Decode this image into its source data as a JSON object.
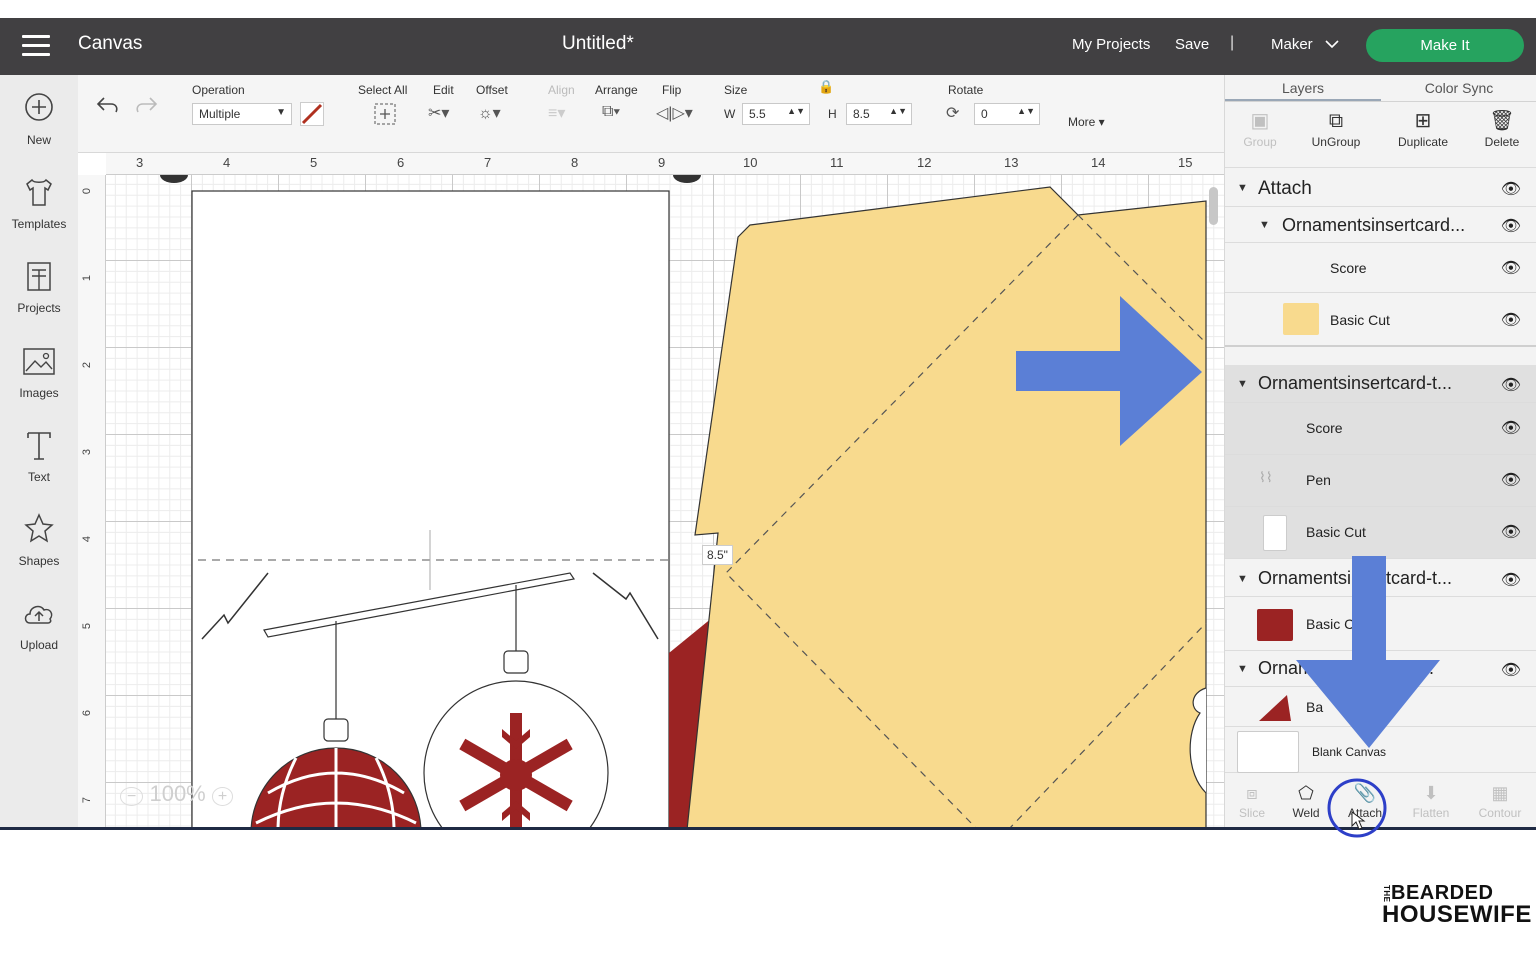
{
  "header": {
    "app_name": "Canvas",
    "doc_title": "Untitled*",
    "my_projects": "My Projects",
    "save": "Save",
    "separator": "|",
    "machine": "Maker",
    "make_it": "Make It"
  },
  "leftbar": {
    "items": [
      {
        "label": "New",
        "icon": "plus-circle-icon"
      },
      {
        "label": "Templates",
        "icon": "shirt-icon"
      },
      {
        "label": "Projects",
        "icon": "projects-icon"
      },
      {
        "label": "Images",
        "icon": "image-icon"
      },
      {
        "label": "Text",
        "icon": "text-icon"
      },
      {
        "label": "Shapes",
        "icon": "shapes-icon"
      },
      {
        "label": "Upload",
        "icon": "upload-cloud-icon"
      }
    ]
  },
  "toolbar": {
    "operation_label": "Operation",
    "operation_value": "Multiple",
    "select_all": "Select All",
    "edit": "Edit",
    "offset": "Offset",
    "align": "Align",
    "arrange": "Arrange",
    "flip": "Flip",
    "size": "Size",
    "width_prefix": "W",
    "width_value": "5.5",
    "height_prefix": "H",
    "height_value": "8.5",
    "rotate": "Rotate",
    "rotate_value": "0",
    "more": "More ▾"
  },
  "canvas": {
    "ruler_top": [
      "3",
      "4",
      "5",
      "6",
      "7",
      "8",
      "9",
      "10",
      "11",
      "12",
      "13",
      "14",
      "15"
    ],
    "ruler_left": [
      "0",
      "1",
      "2",
      "3",
      "4",
      "5",
      "6",
      "7"
    ],
    "dimension_tag": "8.5\"",
    "zoom": "100%",
    "colors": {
      "envelope": "#f8da8e",
      "ornament_red": "#9b2323",
      "outline": "#333333"
    }
  },
  "rightpanel": {
    "tabs": [
      "Layers",
      "Color Sync"
    ],
    "top_tools": [
      {
        "label": "Group",
        "icon": "group-icon",
        "enabled": false
      },
      {
        "label": "UnGroup",
        "icon": "ungroup-icon",
        "enabled": true
      },
      {
        "label": "Duplicate",
        "icon": "duplicate-icon",
        "enabled": true
      },
      {
        "label": "Delete",
        "icon": "trash-icon",
        "enabled": true
      }
    ],
    "layers": {
      "attach": "Attach",
      "group1": "Ornamentsinsertcard...",
      "g1_score": "Score",
      "g1_basic_cut": "Basic Cut",
      "group2": "Ornamentsinsertcard-t...",
      "g2_score": "Score",
      "g2_pen": "Pen",
      "g2_basic_cut": "Basic Cut",
      "group3": "Ornamentsinsertcard-t...",
      "g3_basic": "Basic C",
      "group4": "Ornaments ertcard-t...",
      "g4_basic": "Ba",
      "blank_canvas": "Blank Canvas"
    },
    "bottom_tools": [
      {
        "label": "Slice",
        "icon": "slice-icon",
        "enabled": false
      },
      {
        "label": "Weld",
        "icon": "weld-icon",
        "enabled": true
      },
      {
        "label": "Attach",
        "icon": "attach-icon",
        "enabled": true
      },
      {
        "label": "Flatten",
        "icon": "flatten-icon",
        "enabled": false
      },
      {
        "label": "Contour",
        "icon": "contour-icon",
        "enabled": false
      }
    ]
  },
  "annotation_color": "#5b7fd6",
  "logo": {
    "line1": "BEARDED",
    "line2": "HOUSEWIFE",
    "prefix": "THE"
  }
}
